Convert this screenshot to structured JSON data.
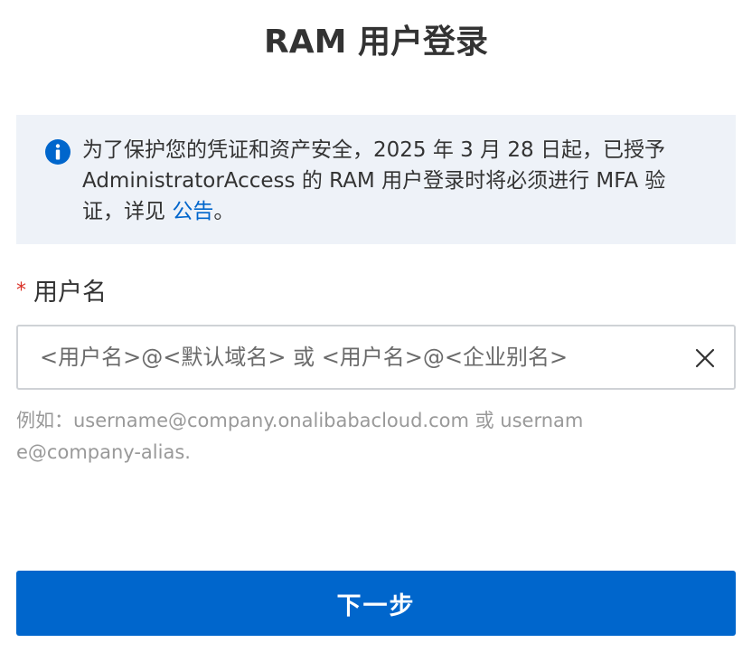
{
  "page": {
    "title": "RAM 用户登录"
  },
  "notice": {
    "icon": "info-icon",
    "text": "为了保护您的凭证和资产安全，2025 年 3 月 28 日起，已授予 AdministratorAccess 的 RAM 用户登录时将必须进行 MFA 验证，详见 ",
    "link_label": "公告",
    "suffix": "。",
    "accent_color": "#0066cc",
    "background_color": "#eef2f8"
  },
  "username_field": {
    "required_mark": "*",
    "label": "用户名",
    "placeholder": "<用户名>@<默认域名> 或 <用户名>@<企业别名>",
    "value": "",
    "clear_icon": "close-icon",
    "hint": "例如：username@company.onalibabacloud.com 或 username@company-alias."
  },
  "actions": {
    "next_label": "下一步",
    "button_color": "#0066cc"
  }
}
